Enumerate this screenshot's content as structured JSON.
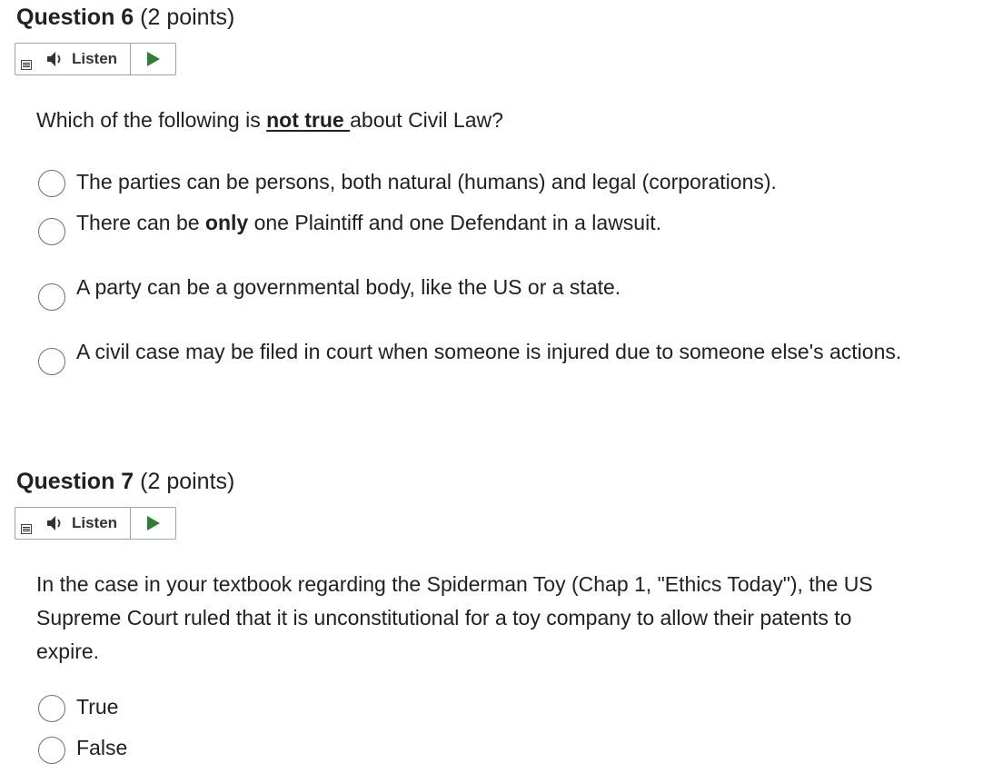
{
  "q6": {
    "title_num": "Question 6",
    "title_pts": "(2 points)",
    "listen_label": "Listen",
    "text_pre": "Which of the following is ",
    "text_emph": "not true ",
    "text_post": "about Civil Law?",
    "options": [
      {
        "label": "The parties can be persons, both natural (humans) and legal (corporations)."
      },
      {
        "label_pre": "There can be ",
        "label_emph": "only",
        "label_post": " one Plaintiff and one Defendant in a lawsuit."
      },
      {
        "label": "A party can be a governmental body, like the US or a state."
      },
      {
        "label": "A civil case may be filed in court when someone is injured due to someone else's actions."
      }
    ]
  },
  "q7": {
    "title_num": "Question 7",
    "title_pts": "(2 points)",
    "listen_label": "Listen",
    "text": "In the case in your textbook regarding the Spiderman Toy (Chap 1, \"Ethics Today\"), the US Supreme Court ruled that it is unconstitutional for a toy company to allow their patents to expire.",
    "options": [
      {
        "label": "True"
      },
      {
        "label": "False"
      }
    ]
  },
  "icons": {
    "speaker": "speaker-icon",
    "play": "play-icon",
    "menu": "menu-icon"
  },
  "colors": {
    "play": "#2e7d32",
    "text": "#202122",
    "border": "#9ca3a8"
  }
}
